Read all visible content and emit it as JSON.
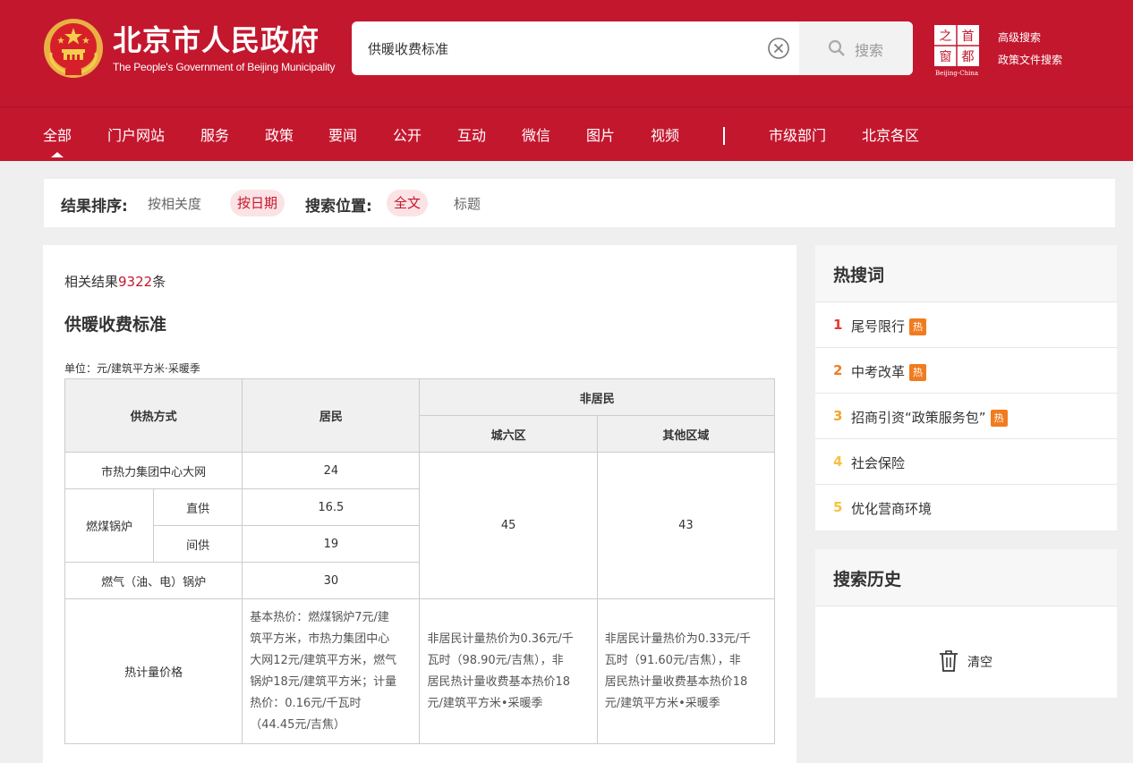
{
  "header": {
    "site_title": "北京市人民政府",
    "site_subtitle": "The People's Government of Beijing Municipality",
    "search": {
      "value": "供暖收费标准",
      "button_label": "搜索"
    },
    "capital_logo": {
      "chars": [
        "之",
        "首",
        "窗",
        "都"
      ],
      "caption": "Beijing-China"
    },
    "advanced_search": "高级搜索",
    "policy_search": "政策文件搜索"
  },
  "nav": {
    "items": [
      "全部",
      "门户网站",
      "服务",
      "政策",
      "要闻",
      "公开",
      "互动",
      "微信",
      "图片",
      "视频"
    ],
    "extra": [
      "市级部门",
      "北京各区"
    ],
    "active": "全部"
  },
  "sortbar": {
    "sort_label": "结果排序:",
    "sort_options": [
      "按相关度",
      "按日期"
    ],
    "sort_active": "按日期",
    "scope_label": "搜索位置:",
    "scope_options": [
      "全文",
      "标题"
    ],
    "scope_active": "全文"
  },
  "results": {
    "count_prefix": "相关结果",
    "count": "9322",
    "count_suffix": "条",
    "title": "供暖收费标准",
    "unit": "单位：元/建筑平方米·采暖季"
  },
  "price_table": {
    "headers": {
      "method": "供热方式",
      "resident": "居民",
      "non_resident": "非居民",
      "city_six": "城六区",
      "other_area": "其他区域"
    },
    "rows": {
      "central_network": {
        "label": "市热力集团中心大网",
        "resident": "24"
      },
      "coal_boiler": {
        "label": "燃煤锅炉"
      },
      "direct": {
        "label": "直供",
        "resident": "16.5"
      },
      "indirect": {
        "label": "间供",
        "resident": "19"
      },
      "gas_boiler": {
        "label": "燃气（油、电）锅炉",
        "resident": "30"
      }
    },
    "non_resident_city_six": "45",
    "non_resident_other": "43",
    "metered": {
      "label": "热计量价格",
      "resident_lines": [
        "基本热价：燃煤锅炉7元/建",
        "筑平方米，市热力集团中心",
        "大网12元/建筑平方米，燃气",
        "锅炉18元/建筑平方米；计量",
        "热价：0.16元/千瓦时",
        "（44.45元/吉焦）"
      ],
      "city_six_lines": [
        "非居民计量热价为0.36元/千",
        "瓦时（98.90元/吉焦），非",
        "居民热计量收费基本热价18",
        "元/建筑平方米•采暖季"
      ],
      "other_lines": [
        "非居民计量热价为0.33元/千",
        "瓦时（91.60元/吉焦），非",
        "居民热计量收费基本热价18",
        "元/建筑平方米•采暖季"
      ]
    }
  },
  "hot_search": {
    "title": "热搜词",
    "badge": "热",
    "items": [
      {
        "rank": "1",
        "text": "尾号限行",
        "hot": true
      },
      {
        "rank": "2",
        "text": "中考改革",
        "hot": true
      },
      {
        "rank": "3",
        "text": "招商引资“政策服务包”",
        "hot": true
      },
      {
        "rank": "4",
        "text": "社会保险",
        "hot": false
      },
      {
        "rank": "5",
        "text": "优化营商环境",
        "hot": false
      }
    ],
    "rank_colors": [
      "#e4392e",
      "#f07c1f",
      "#f3a62c",
      "#f5c242",
      "#f5c242"
    ]
  },
  "history": {
    "title": "搜索历史",
    "clear_label": "清空"
  },
  "colors": {
    "brand_red": "#c3172e",
    "hot_badge": "#f07c1f",
    "pill_bg": "#fbe3e5"
  }
}
